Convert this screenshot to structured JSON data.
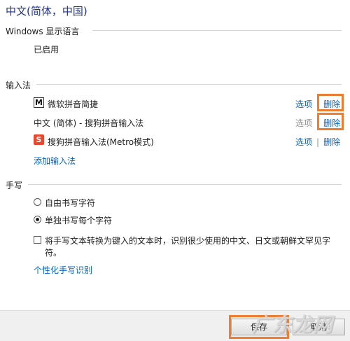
{
  "title": "中文(简体，中国)",
  "display_language": {
    "label": "Windows 显示语言",
    "status": "已启用"
  },
  "input_methods": {
    "label": "输入法",
    "items": [
      {
        "icon": "M",
        "name": "微软拼音简捷",
        "options": "选项",
        "delete": "删除",
        "options_enabled": true
      },
      {
        "icon": "",
        "name": "中文 (简体) - 搜狗拼音输入法",
        "options": "选项",
        "delete": "删除",
        "options_enabled": false
      },
      {
        "icon": "S",
        "name": "搜狗拼音输入法(Metro模式)",
        "options": "选项",
        "delete": "删除",
        "options_enabled": true
      }
    ],
    "separator": "|",
    "add_link": "添加输入法"
  },
  "handwriting": {
    "label": "手写",
    "option_freeform": "自由书写字符",
    "option_single": "单独书写每个字符",
    "selected": "单独书写每个字符",
    "checkbox_label_line1": "将手写文本转换为键入的文本时，识别很少使用的中文、日文或朝鲜文罕见字",
    "checkbox_label_line2": "符。",
    "checkbox_checked": false,
    "personalize_link": "个性化手写识别"
  },
  "footer": {
    "save_label": "保存",
    "cancel_label": "取消"
  },
  "watermark": "广东龙网",
  "colors": {
    "title": "#1e3287",
    "link": "#0066cc",
    "highlight": "#ed7d31"
  }
}
